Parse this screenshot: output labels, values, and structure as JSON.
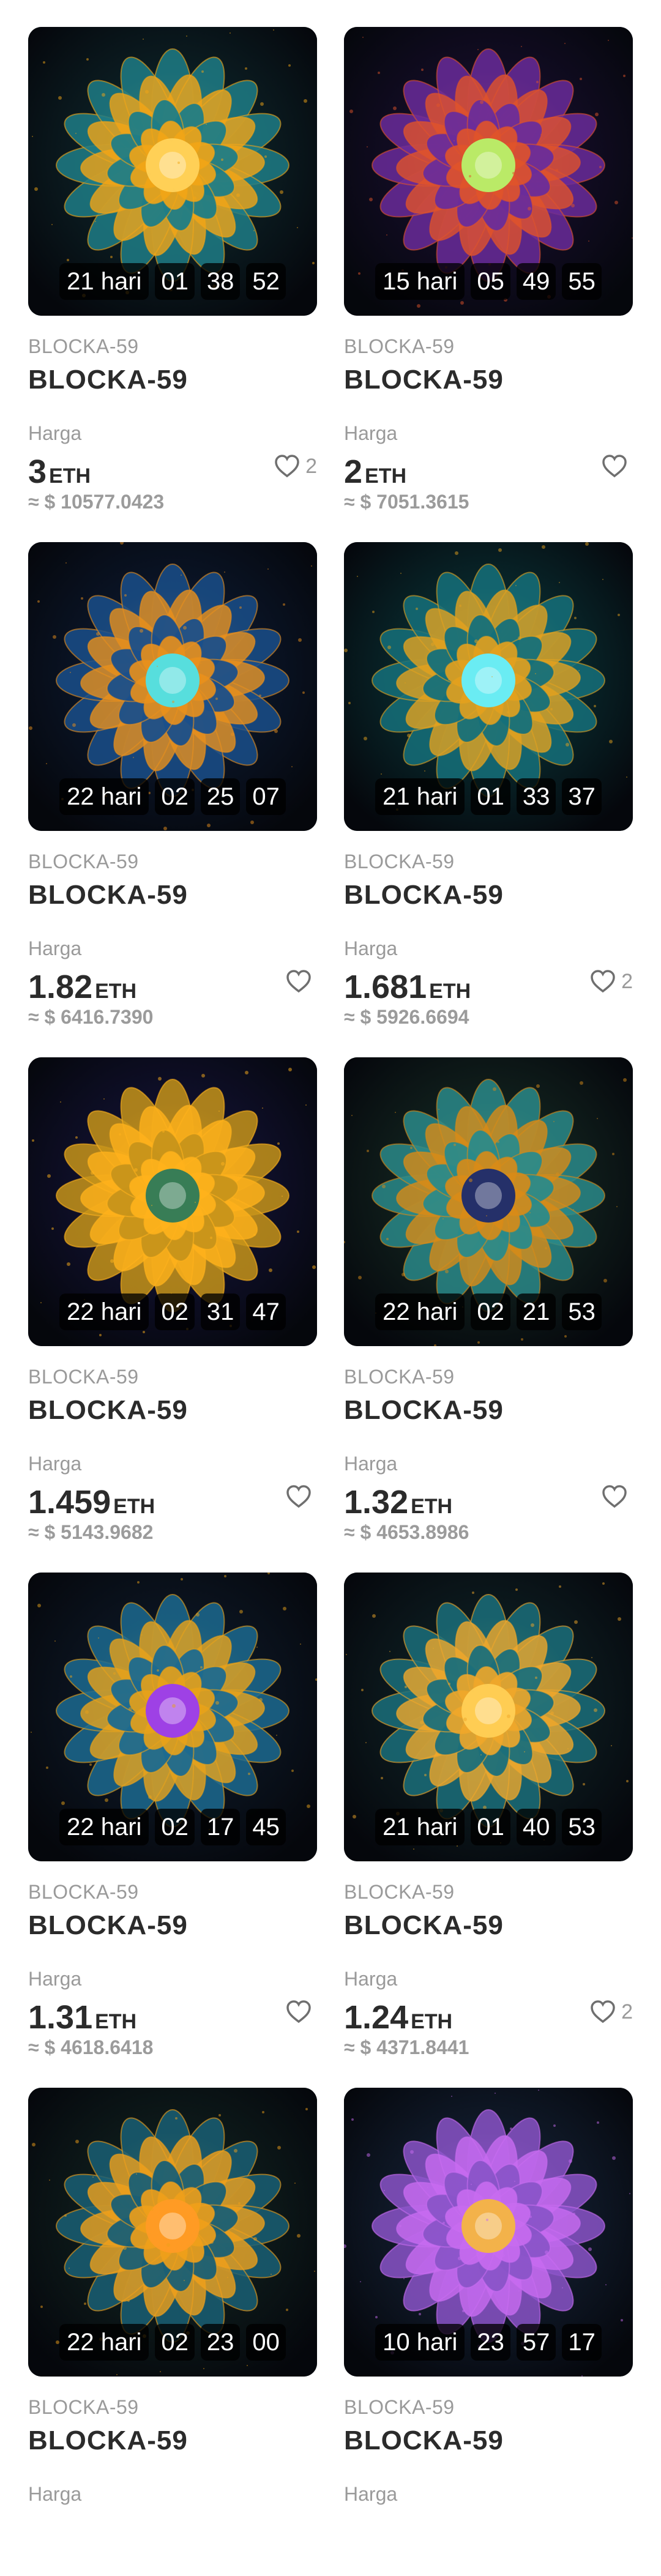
{
  "labels": {
    "price_label": "Harga",
    "currency": "ETH",
    "usd_prefix": "≈ $ "
  },
  "items": [
    {
      "subtitle": "BLOCKA-59",
      "title": "BLOCKA-59",
      "timer": {
        "days": "21 hari",
        "h": "01",
        "m": "38",
        "s": "52"
      },
      "price": "3",
      "usd": "10577.0423",
      "likes": "2",
      "palette": {
        "bg": "#0b1d22",
        "glow": "#f2a516",
        "petal": "#1f7d86",
        "core": "#ffd25a"
      }
    },
    {
      "subtitle": "BLOCKA-59",
      "title": "BLOCKA-59",
      "timer": {
        "days": "15 hari",
        "h": "05",
        "m": "49",
        "s": "55"
      },
      "price": "2",
      "usd": "7051.3615",
      "likes": "",
      "palette": {
        "bg": "#120c24",
        "glow": "#e0532a",
        "petal": "#6a2c9a",
        "core": "#b7f26a"
      }
    },
    {
      "subtitle": "BLOCKA-59",
      "title": "BLOCKA-59",
      "timer": {
        "days": "22 hari",
        "h": "02",
        "m": "25",
        "s": "07"
      },
      "price": "1.82",
      "usd": "6416.7390",
      "likes": "",
      "palette": {
        "bg": "#0a1426",
        "glow": "#e9901c",
        "petal": "#1a4f8a",
        "core": "#4fe3e8"
      }
    },
    {
      "subtitle": "BLOCKA-59",
      "title": "BLOCKA-59",
      "timer": {
        "days": "21 hari",
        "h": "01",
        "m": "33",
        "s": "37"
      },
      "price": "1.681",
      "usd": "5926.6694",
      "likes": "2",
      "palette": {
        "bg": "#08262a",
        "glow": "#e3a11e",
        "petal": "#15707a",
        "core": "#63f0ff"
      }
    },
    {
      "subtitle": "BLOCKA-59",
      "title": "BLOCKA-59",
      "timer": {
        "days": "22 hari",
        "h": "02",
        "m": "31",
        "s": "47"
      },
      "price": "1.459",
      "usd": "5143.9682",
      "likes": "",
      "palette": {
        "bg": "#0f0f2a",
        "glow": "#ffb21c",
        "petal": "#c7941a",
        "core": "#2d7a5a"
      }
    },
    {
      "subtitle": "BLOCKA-59",
      "title": "BLOCKA-59",
      "timer": {
        "days": "22 hari",
        "h": "02",
        "m": "21",
        "s": "53"
      },
      "price": "1.32",
      "usd": "4653.8986",
      "likes": "",
      "palette": {
        "bg": "#101f1c",
        "glow": "#d88b17",
        "petal": "#2a8a8a",
        "core": "#1b2b6e"
      }
    },
    {
      "subtitle": "BLOCKA-59",
      "title": "BLOCKA-59",
      "timer": {
        "days": "22 hari",
        "h": "02",
        "m": "17",
        "s": "45"
      },
      "price": "1.31",
      "usd": "4618.6418",
      "likes": "",
      "palette": {
        "bg": "#0b1420",
        "glow": "#e8a21a",
        "petal": "#1c6a8f",
        "core": "#9a3cf0"
      }
    },
    {
      "subtitle": "BLOCKA-59",
      "title": "BLOCKA-59",
      "timer": {
        "days": "21 hari",
        "h": "01",
        "m": "40",
        "s": "53"
      },
      "price": "1.24",
      "usd": "4371.8441",
      "likes": "2",
      "palette": {
        "bg": "#0c1a1e",
        "glow": "#f0a72a",
        "petal": "#1b6f7a",
        "core": "#ffcf55"
      }
    },
    {
      "subtitle": "BLOCKA-59",
      "title": "BLOCKA-59",
      "timer": {
        "days": "22 hari",
        "h": "02",
        "m": "23",
        "s": "00"
      },
      "price": "",
      "usd": "",
      "likes": "",
      "palette": {
        "bg": "#0d1a1a",
        "glow": "#f0a01a",
        "petal": "#1a5f74",
        "core": "#ff9b25"
      }
    },
    {
      "subtitle": "BLOCKA-59",
      "title": "BLOCKA-59",
      "timer": {
        "days": "10 hari",
        "h": "23",
        "m": "57",
        "s": "17"
      },
      "price": "",
      "usd": "",
      "likes": "",
      "palette": {
        "bg": "#101a2a",
        "glow": "#c86cf0",
        "petal": "#8a54c8",
        "core": "#f5b640"
      }
    }
  ]
}
